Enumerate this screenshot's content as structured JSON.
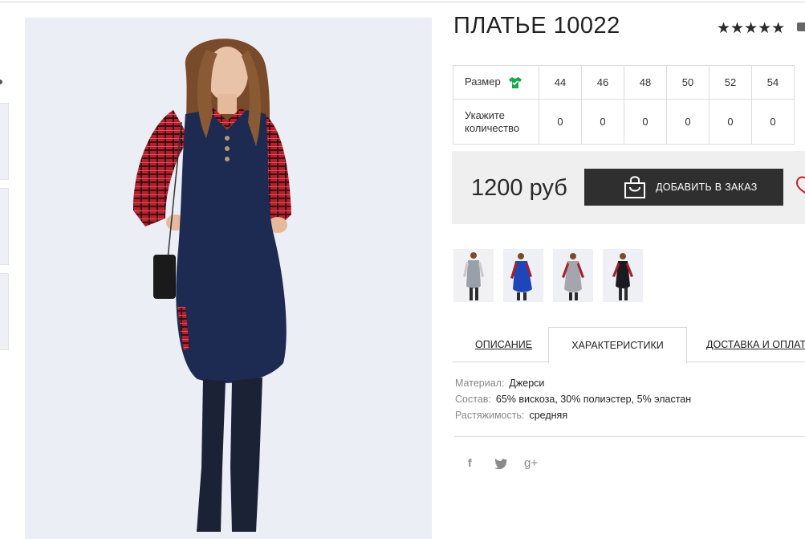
{
  "product": {
    "title": "ПЛАТЬЕ 10022",
    "rating_stars": "★★★★★",
    "price": "1200 руб",
    "add_to_order_label": "ДОБАВИТЬ В ЗАКАЗ"
  },
  "size_table": {
    "size_label": "Размер",
    "qty_label_line1": "Укажите",
    "qty_label_line2": "количество",
    "sizes": [
      "44",
      "46",
      "48",
      "50",
      "52",
      "54"
    ],
    "quantities": [
      "0",
      "0",
      "0",
      "0",
      "0",
      "0"
    ]
  },
  "tabs": {
    "description": "ОПИСАНИЕ",
    "characteristics": "ХАРАКТЕРИСТИКИ",
    "delivery": "ДОСТАВКА И ОПЛАТА"
  },
  "specs": [
    {
      "label": "Материал:",
      "value": "Джерси"
    },
    {
      "label": "Состав:",
      "value": "65% вискоза, 30% полиэстер, 5% эластан"
    },
    {
      "label": "Растяжимость:",
      "value": "средняя"
    }
  ],
  "social": {
    "facebook": "f",
    "googleplus": "g+"
  },
  "colors": {
    "button_bg": "#2f2f2f",
    "price_box_bg": "#efefef",
    "size_icon": "#1aa84a",
    "dress_navy": "#1d2b52",
    "plaid_red": "#c0202c"
  }
}
